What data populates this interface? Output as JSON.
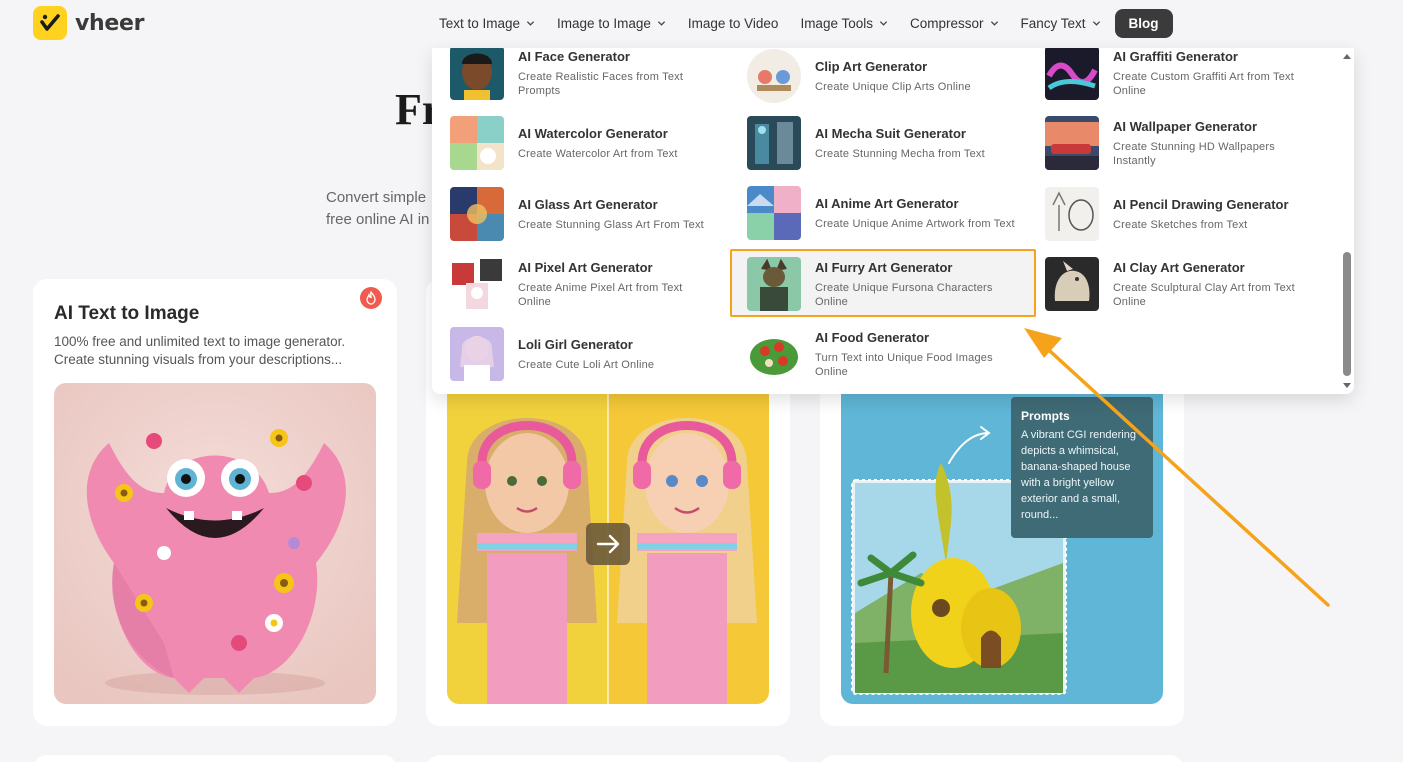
{
  "brand": {
    "name": "vheer",
    "color": "#ffd21f"
  },
  "nav": {
    "items": [
      {
        "label": "Text to Image",
        "dropdown": true
      },
      {
        "label": "Image to Image",
        "dropdown": true
      },
      {
        "label": "Image to Video",
        "dropdown": false
      },
      {
        "label": "Image Tools",
        "dropdown": true
      },
      {
        "label": "Compressor",
        "dropdown": true
      },
      {
        "label": "Fancy Text",
        "dropdown": true
      }
    ],
    "blog_label": "Blog"
  },
  "hero": {
    "title_partial": "Fr",
    "subtitle_partial": "Convert simple free online AI in"
  },
  "cards": [
    {
      "title": "AI Text to Image",
      "description": "100% free and unlimited text to image generator. Create stunning visuals from your descriptions..."
    },
    {},
    {
      "prompt_label": "Prompts",
      "prompt_text": "A vibrant CGI rendering depicts a whimsical, banana-shaped house with a bright yellow exterior and a small, round..."
    }
  ],
  "dropdown": {
    "items": [
      {
        "title": "AI Face Generator",
        "desc": "Create Realistic Faces from Text Prompts"
      },
      {
        "title": "Clip Art Generator",
        "desc": "Create Unique Clip Arts Online"
      },
      {
        "title": "AI Graffiti Generator",
        "desc": "Create Custom Graffiti Art from Text Online"
      },
      {
        "title": "AI Watercolor Generator",
        "desc": "Create Watercolor Art from Text"
      },
      {
        "title": "AI Mecha Suit Generator",
        "desc": "Create Stunning Mecha from Text"
      },
      {
        "title": "AI Wallpaper Generator",
        "desc": "Create Stunning HD Wallpapers Instantly"
      },
      {
        "title": "AI Glass Art Generator",
        "desc": "Create Stunning Glass Art From Text"
      },
      {
        "title": "AI Anime Art Generator",
        "desc": "Create Unique Anime Artwork from Text"
      },
      {
        "title": "AI Pencil Drawing Generator",
        "desc": "Create Sketches from Text"
      },
      {
        "title": "AI Pixel Art Generator",
        "desc": "Create Anime Pixel Art from Text Online"
      },
      {
        "title": "AI Furry Art Generator",
        "desc": "Create Unique Fursona Characters Online"
      },
      {
        "title": "AI Clay Art Generator",
        "desc": "Create Sculptural Clay Art from Text Online"
      },
      {
        "title": "Loli Girl Generator",
        "desc": "Create Cute Loli Art Online"
      },
      {
        "title": "AI Food Generator",
        "desc": "Turn Text into Unique Food Images Online"
      }
    ],
    "highlighted_item": "AI Furry Art Generator"
  },
  "colors": {
    "highlight": "#f5a31a",
    "annotation_arrow": "#f5a31a",
    "dark_button": "#3b3b3b"
  }
}
